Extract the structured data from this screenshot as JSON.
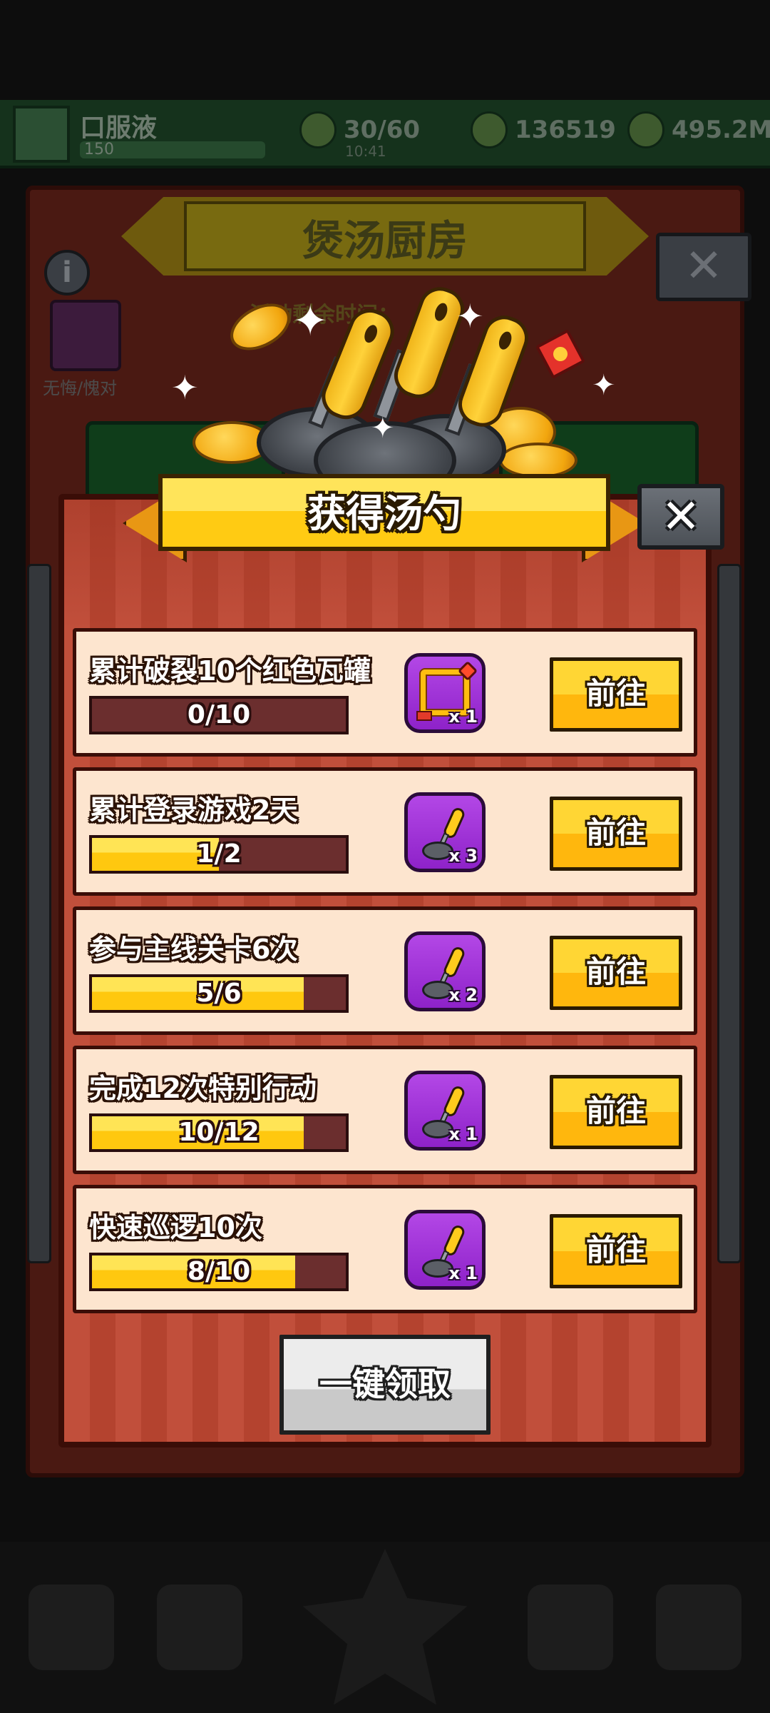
{
  "background": {
    "player_name": "口服液",
    "player_level": "150",
    "energy": "30/60",
    "energy_timer": "10:41",
    "gems": "136519",
    "coins": "495.2M",
    "event_title": "煲汤厨房",
    "event_timer_label": "活动剩余时间：",
    "side_label": "无悔/愧对"
  },
  "modal": {
    "title": "获得汤勺",
    "close_icon": "close-icon",
    "claim_all_label": "一键领取",
    "colors": {
      "panel": "#c14f3b",
      "row": "#fde5cf",
      "progress_fill": "#ffc80f",
      "progress_track": "#6b2e2e",
      "reward_slot": "#9b2fd4",
      "go_button": "#ffc41a",
      "claim_button": "#d9d9d9"
    },
    "tasks": [
      {
        "title": "累计破裂10个红色瓦罐",
        "progress_text": "0/10",
        "progress": 0.0,
        "reward_icon": "frame-icon",
        "reward_qty": "x 1",
        "button_label": "前往"
      },
      {
        "title": "累计登录游戏2天",
        "progress_text": "1/2",
        "progress": 0.5,
        "reward_icon": "ladle-icon",
        "reward_qty": "x 3",
        "button_label": "前往"
      },
      {
        "title": "参与主线关卡6次",
        "progress_text": "5/6",
        "progress": 0.833,
        "reward_icon": "ladle-icon",
        "reward_qty": "x 2",
        "button_label": "前往"
      },
      {
        "title": "完成12次特别行动",
        "progress_text": "10/12",
        "progress": 0.833,
        "reward_icon": "ladle-icon",
        "reward_qty": "x 1",
        "button_label": "前往"
      },
      {
        "title": "快速巡逻10次",
        "progress_text": "8/10",
        "progress": 0.8,
        "reward_icon": "ladle-icon",
        "reward_qty": "x 1",
        "button_label": "前往"
      }
    ]
  }
}
